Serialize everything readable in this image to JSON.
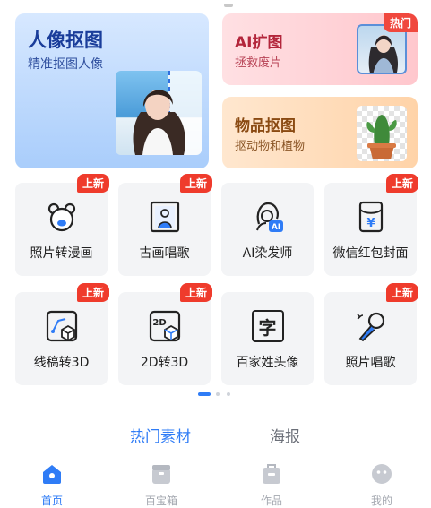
{
  "hero": {
    "portrait": {
      "title": "人像抠图",
      "subtitle": "精准抠图人像"
    },
    "expand": {
      "title": "AI扩图",
      "subtitle": "拯救废片",
      "badge": "热门"
    },
    "object": {
      "title": "物品抠图",
      "subtitle": "抠动物和植物"
    }
  },
  "tools": [
    {
      "label": "照片转漫画",
      "badge": "上新",
      "icon": "bear-face-icon"
    },
    {
      "label": "古画唱歌",
      "badge": "上新",
      "icon": "framed-portrait-icon"
    },
    {
      "label": "AI染发师",
      "badge": "",
      "icon": "ai-hair-icon"
    },
    {
      "label": "微信红包封面",
      "badge": "上新",
      "icon": "red-envelope-icon"
    },
    {
      "label": "线稿转3D",
      "badge": "上新",
      "icon": "sketch-to-3d-icon"
    },
    {
      "label": "2D转3D",
      "badge": "上新",
      "icon": "2d-to-3d-icon"
    },
    {
      "label": "百家姓头像",
      "badge": "",
      "icon": "surname-character-icon"
    },
    {
      "label": "照片唱歌",
      "badge": "上新",
      "icon": "microphone-icon"
    }
  ],
  "surname_glyph": "字",
  "tabs": [
    {
      "label": "热门素材",
      "active": true
    },
    {
      "label": "海报",
      "active": false
    }
  ],
  "nav": [
    {
      "label": "首页",
      "active": true,
      "icon": "home-icon"
    },
    {
      "label": "百宝箱",
      "active": false,
      "icon": "toolbox-icon"
    },
    {
      "label": "作品",
      "active": false,
      "icon": "works-icon"
    },
    {
      "label": "我的",
      "active": false,
      "icon": "profile-icon"
    }
  ],
  "colors": {
    "accent": "#2f7cf6",
    "badge": "#ef3b2c",
    "inactive": "#b0b4bc"
  }
}
